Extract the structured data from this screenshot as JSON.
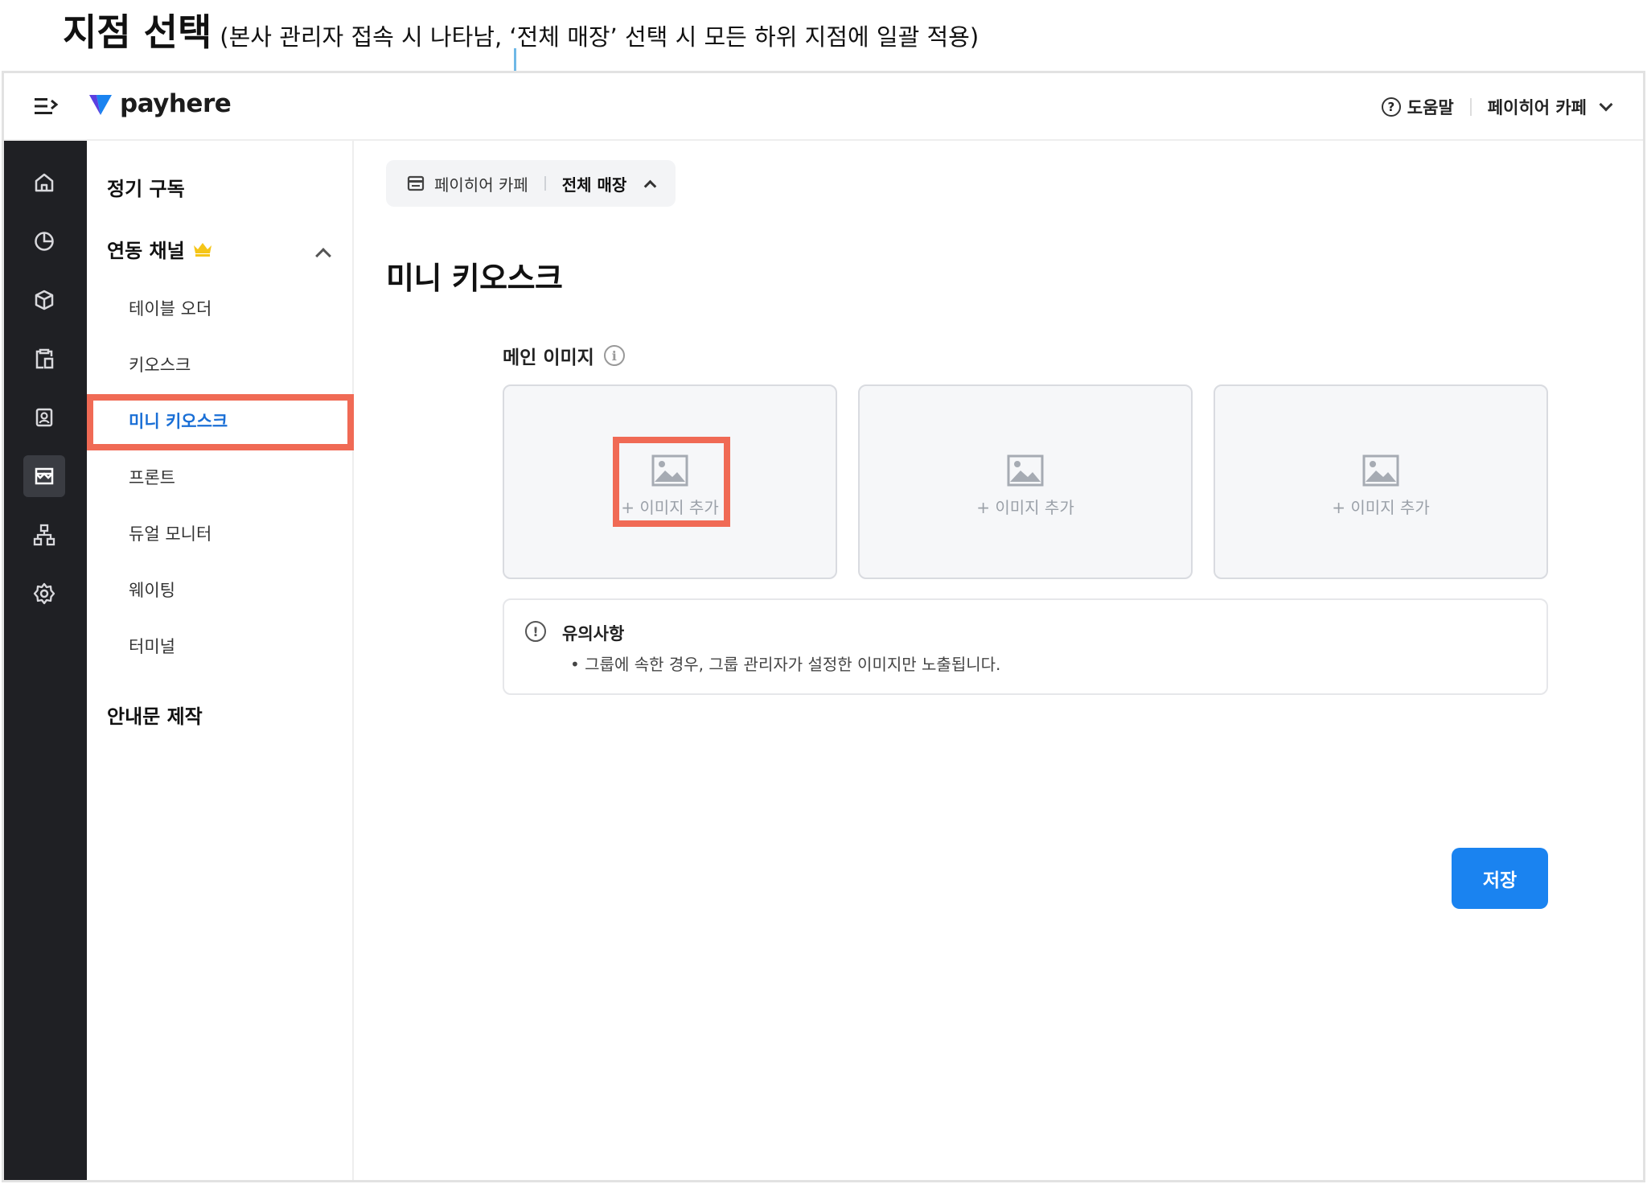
{
  "annotation": {
    "title": "지점 선택",
    "description": "(본사 관리자 접속 시 나타남, ‘전체 매장’ 선택 시 모든 하위 지점에 일괄 적용)"
  },
  "header": {
    "menu_icon": "menu-toggle-icon",
    "logo_text": "payhere",
    "help_label": "도움말",
    "help_icon_glyph": "?",
    "store_name": "페이히어 카페"
  },
  "rail": {
    "items": [
      {
        "icon": "home-icon",
        "active": false
      },
      {
        "icon": "pie-chart-icon",
        "active": false
      },
      {
        "icon": "box-icon",
        "active": false
      },
      {
        "icon": "clipboard-icon",
        "active": false
      },
      {
        "icon": "contact-icon",
        "active": false
      },
      {
        "icon": "storefront-icon",
        "active": true
      },
      {
        "icon": "org-chart-icon",
        "active": false
      },
      {
        "icon": "settings-icon",
        "active": false
      }
    ]
  },
  "subnav": {
    "subscription": "정기 구독",
    "linked_channels": "연동 채널",
    "items": [
      "테이블 오더",
      "키오스크",
      "미니 키오스크",
      "프론트",
      "듀얼 모니터",
      "웨이팅",
      "터미널"
    ],
    "active_item": "미니 키오스크",
    "notice_making": "안내문 제작"
  },
  "main": {
    "branch": {
      "store": "페이히어 카페",
      "scope": "전체 매장"
    },
    "title": "미니 키오스크",
    "main_image_label": "메인 이미지",
    "info_glyph": "i",
    "slots": [
      {
        "label": "+ 이미지 추가"
      },
      {
        "label": "+ 이미지 추가"
      },
      {
        "label": "+ 이미지 추가"
      }
    ],
    "notice": {
      "glyph": "!",
      "title": "유의사항",
      "text": "•  그룹에 속한 경우, 그룹 관리자가 설정한 이미지만 노출됩니다."
    },
    "save_label": "저장"
  },
  "colors": {
    "accent": "#1a83f0",
    "highlight": "#f06a55",
    "rail_bg": "#1f2024",
    "active_text": "#1a6fd6"
  }
}
